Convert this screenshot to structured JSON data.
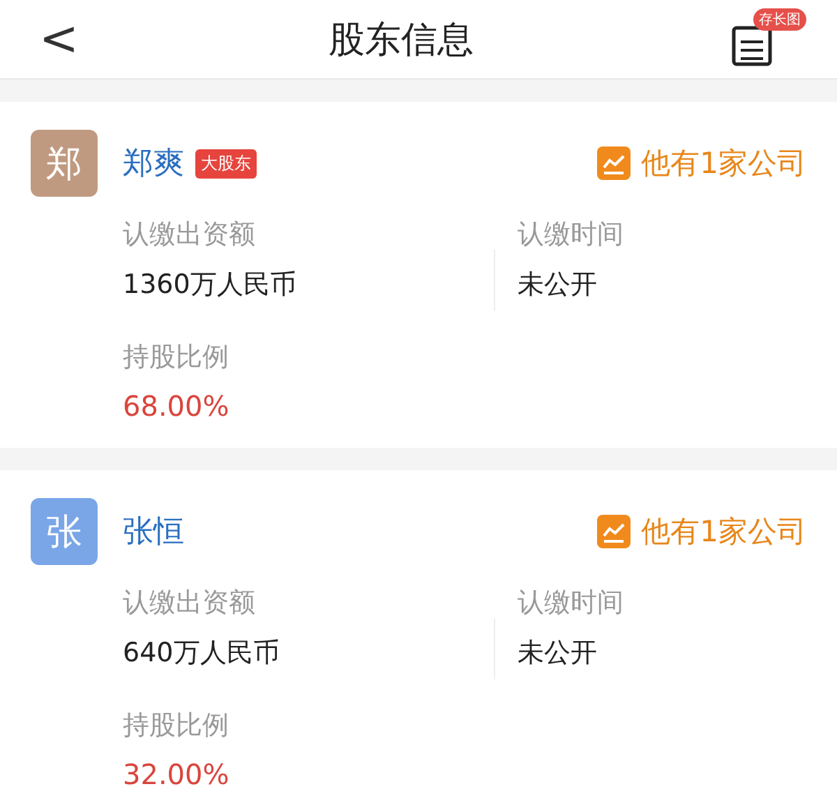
{
  "header": {
    "back": "<",
    "title": "股东信息",
    "save_badge": "存长图"
  },
  "shareholders": [
    {
      "avatar": "郑",
      "color": "#c09a80",
      "name": "郑爽",
      "tag": "大股东",
      "companies": "他有1家公司",
      "amount_label": "认缴出资额",
      "amount": "1360万人民币",
      "time_label": "认缴时间",
      "time": "未公开",
      "ratio_label": "持股比例",
      "ratio": "68.00%"
    },
    {
      "avatar": "张",
      "color": "#7aa6e8",
      "name": "张恒",
      "companies": "他有1家公司",
      "amount_label": "认缴出资额",
      "amount": "640万人民币",
      "time_label": "认缴时间",
      "time": "未公开",
      "ratio_label": "持股比例",
      "ratio": "32.00%"
    }
  ]
}
